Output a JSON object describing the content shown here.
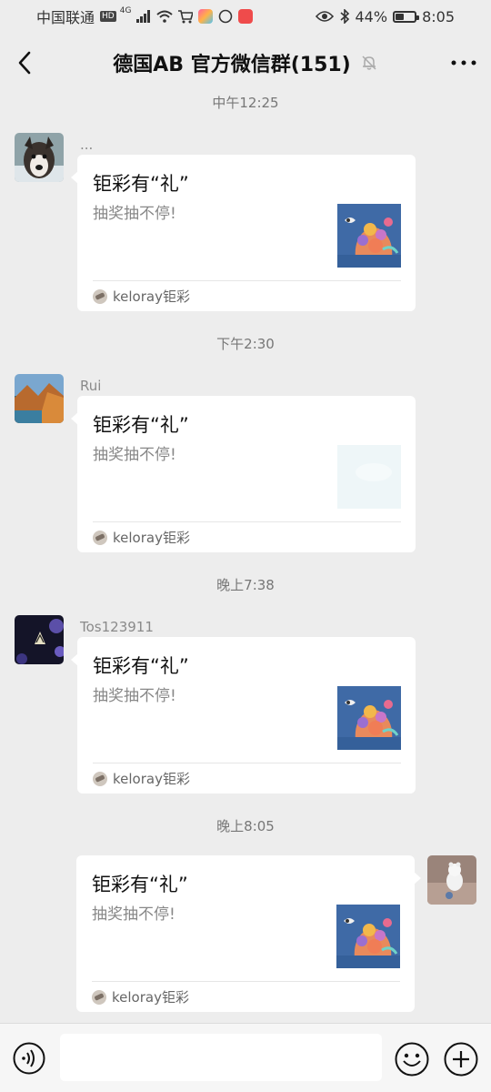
{
  "status_bar": {
    "carrier": "中国联通",
    "hd_badge": "HD",
    "net_type": "4G",
    "battery": "44%",
    "battery_level": 0.44,
    "time": "8:05"
  },
  "nav": {
    "title": "德国AB  官方微信群(151)"
  },
  "messages": [
    {
      "time": "中午12:25",
      "sender": "...",
      "side": "left",
      "card_title": "钜彩有“礼”",
      "card_desc": "抽奖抽不停!",
      "source": "keloray钜彩",
      "thumb": "coral-icon"
    },
    {
      "time": "下午2:30",
      "sender": "Rui",
      "side": "left",
      "card_title": "钜彩有“礼”",
      "card_desc": "抽奖抽不停!",
      "source": "keloray钜彩",
      "thumb": "blank-thumb-icon"
    },
    {
      "time": "晚上7:38",
      "sender": "Tos123911",
      "side": "left",
      "card_title": "钜彩有“礼”",
      "card_desc": "抽奖抽不停!",
      "source": "keloray钜彩",
      "thumb": "coral-icon"
    },
    {
      "time": "晚上8:05",
      "sender": "",
      "side": "right",
      "card_title": "钜彩有“礼”",
      "card_desc": "抽奖抽不停!",
      "source": "keloray钜彩",
      "thumb": "coral-icon"
    }
  ],
  "input": {
    "value": "",
    "placeholder": ""
  },
  "colors": {
    "background": "#ededed",
    "card": "#ffffff",
    "time_text": "#777777",
    "sender_text": "#8a8a8a",
    "thumb_blue": "#3f6aa6"
  }
}
